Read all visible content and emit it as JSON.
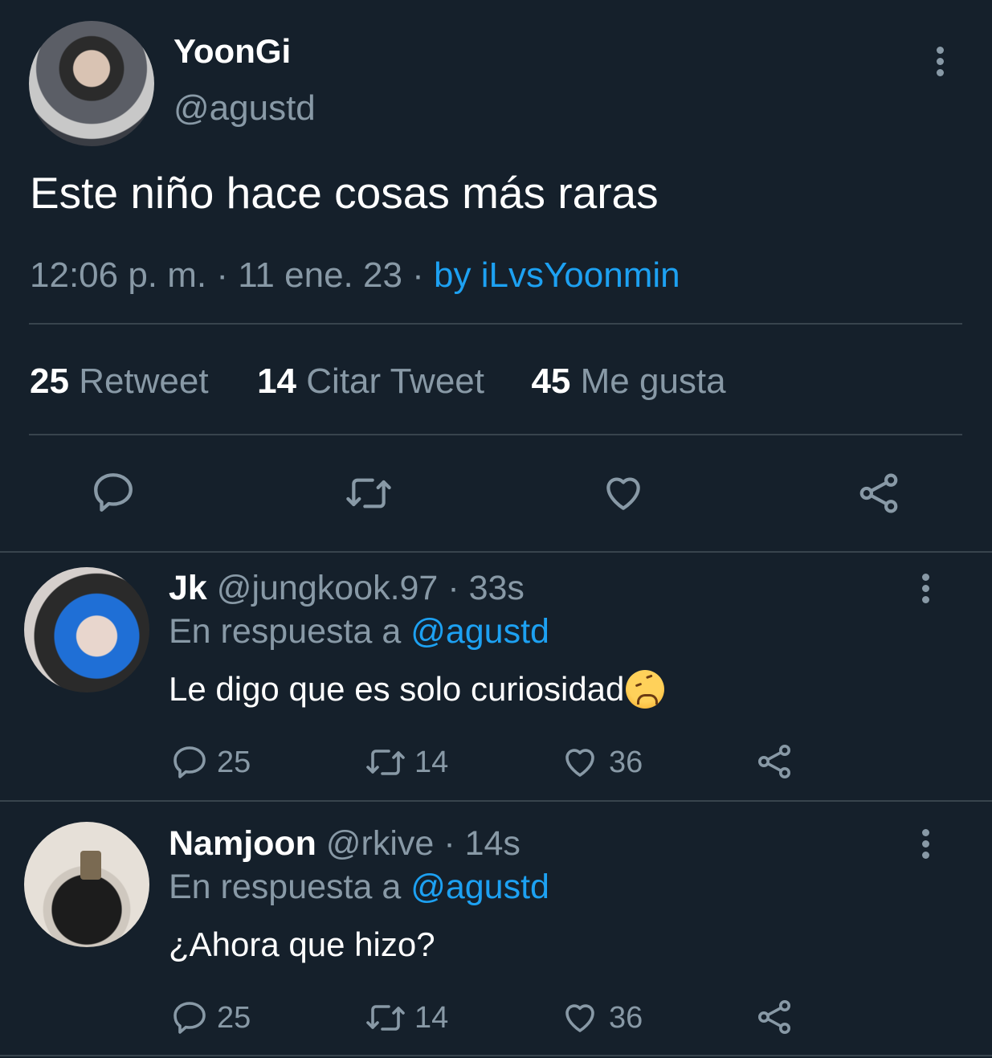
{
  "tweet": {
    "author_name": "YoonGi",
    "author_handle": "@agustd",
    "text": "Este niño hace cosas más raras",
    "timestamp": "12:06 p. m. · 11 ene. 23",
    "separator": " · ",
    "source": "by iLvsYoonmin",
    "stats": {
      "retweets_count": "25",
      "retweets_label": "Retweet",
      "quotes_count": "14",
      "quotes_label": "Citar Tweet",
      "likes_count": "45",
      "likes_label": "Me gusta"
    },
    "actions": [
      "reply-icon",
      "retweet-icon",
      "like-icon",
      "share-icon"
    ]
  },
  "replies": [
    {
      "name": "Jk",
      "handle": "@jungkook.97",
      "time": "· 33s",
      "reply_prefix": "En respuesta a",
      "reply_to": "@agustd",
      "text": "Le digo que es solo curiosidad",
      "emoji": "weary-face-emoji",
      "reply_count": "25",
      "retweet_count": "14",
      "like_count": "36"
    },
    {
      "name": "Namjoon",
      "handle": "@rkive",
      "time": "· 14s",
      "reply_prefix": "En respuesta a",
      "reply_to": "@agustd",
      "text": "¿Ahora que hizo?",
      "reply_count": "25",
      "retweet_count": "14",
      "like_count": "36"
    }
  ],
  "colors": {
    "background": "#15202b",
    "text": "#ffffff",
    "muted": "#8899a6",
    "link": "#1da1f2",
    "divider": "#38444d"
  }
}
